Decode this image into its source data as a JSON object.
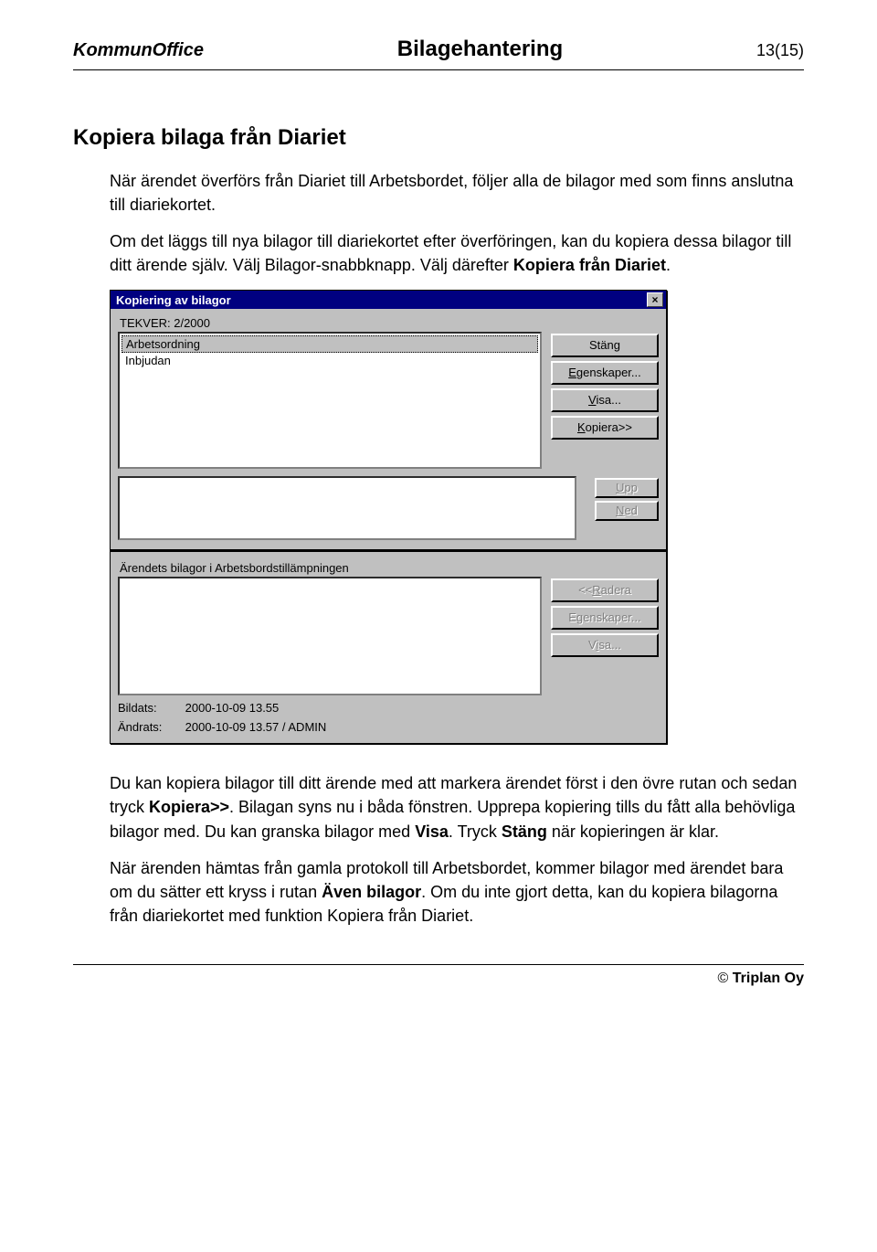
{
  "header": {
    "left": "KommunOffice",
    "center": "Bilagehantering",
    "right": "13(15)"
  },
  "section_title": "Kopiera bilaga från Diariet",
  "para1": "När ärendet överförs från Diariet till Arbetsbordet, följer alla de bilagor med som finns anslutna till diariekortet.",
  "para2_a": "Om det läggs till nya bilagor till diariekortet efter överföringen, kan du kopiera dessa bilagor till ditt ärende själv. Välj Bilagor-snabbknapp. Välj därefter ",
  "para2_b": "Kopiera från Diariet",
  "para2_c": ".",
  "dialog": {
    "title": "Kopiering av bilagor",
    "close": "×",
    "header_label": "TEKVER: 2/2000",
    "list1": [
      "Arbetsordning",
      "Inbjudan"
    ],
    "buttons1": {
      "close": "Stäng",
      "props": "Egenskaper...",
      "show": "Visa...",
      "copy": "Kopiera>>"
    },
    "buttons_mid": {
      "up": "Upp",
      "down": "Ned"
    },
    "section2_label": "Ärendets bilagor i Arbetsbordstillämpningen",
    "buttons2": {
      "delete": "<<Radera",
      "props": "Egenskaper...",
      "show": "Visa..."
    },
    "meta": {
      "created_lbl": "Bildats:",
      "created_val": "2000-10-09 13.55",
      "changed_lbl": "Ändrats:",
      "changed_val": "2000-10-09 13.57 / ADMIN"
    }
  },
  "para3_a": "Du kan kopiera bilagor till ditt ärende med att markera ärendet först i den övre rutan och sedan tryck ",
  "para3_b": "Kopiera>>",
  "para3_c": ". Bilagan syns nu i båda fönstren. Upprepa kopiering tills du fått alla behövliga bilagor med. Du kan granska bilagor med ",
  "para3_d": "Visa",
  "para3_e": ". Tryck ",
  "para3_f": "Stäng",
  "para3_g": " när kopieringen är klar.",
  "para4_a": "När ärenden hämtas från gamla protokoll till Arbetsbordet, kommer bilagor med ärendet bara om du sätter ett kryss i rutan ",
  "para4_b": "Även bilagor",
  "para4_c": ". Om du inte gjort detta, kan du kopiera bilagorna från diariekortet med funktion Kopiera från Diariet.",
  "footer": {
    "copy": "© ",
    "brand": "Triplan Oy"
  }
}
